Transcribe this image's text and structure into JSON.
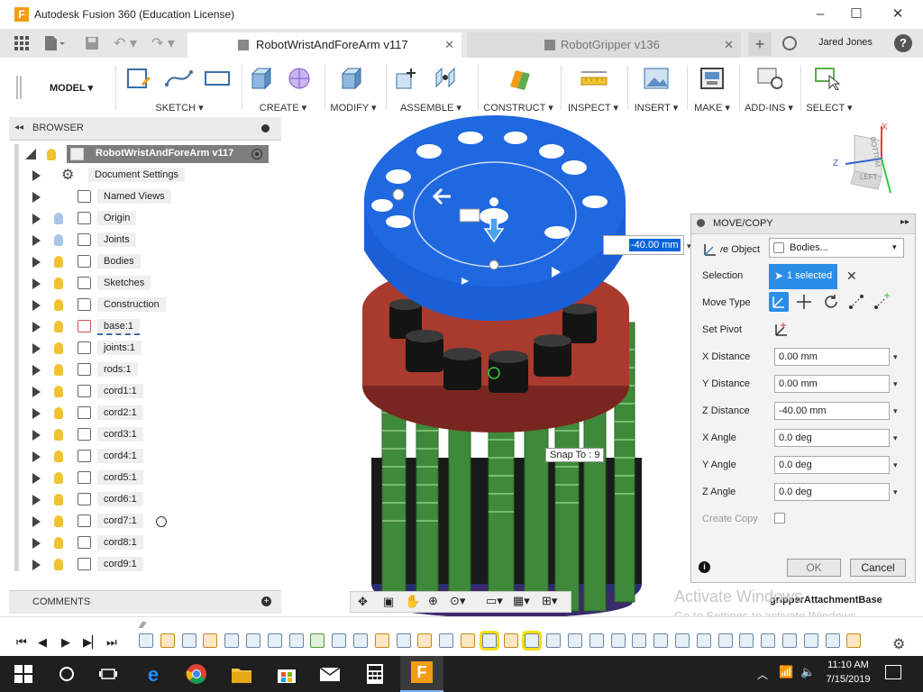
{
  "window": {
    "title": "Autodesk Fusion 360 (Education License)",
    "user": "Jared Jones"
  },
  "tabs": [
    {
      "label": "RobotWristAndForeArm v117"
    },
    {
      "label": "RobotGripper v136"
    }
  ],
  "toolbar": {
    "mode": "MODEL",
    "groups": [
      {
        "label": "SKETCH"
      },
      {
        "label": "CREATE"
      },
      {
        "label": "MODIFY"
      },
      {
        "label": "ASSEMBLE"
      },
      {
        "label": "CONSTRUCT"
      },
      {
        "label": "INSPECT"
      },
      {
        "label": "INSERT"
      },
      {
        "label": "MAKE"
      },
      {
        "label": "ADD-INS"
      },
      {
        "label": "SELECT"
      }
    ]
  },
  "browser": {
    "title": "BROWSER",
    "root": "RobotWristAndForeArm v117",
    "items": [
      {
        "label": "Document Settings"
      },
      {
        "label": "Named Views"
      },
      {
        "label": "Origin"
      },
      {
        "label": "Joints"
      },
      {
        "label": "Bodies"
      },
      {
        "label": "Sketches"
      },
      {
        "label": "Construction"
      },
      {
        "label": "base:1"
      },
      {
        "label": "joints:1"
      },
      {
        "label": "rods:1"
      },
      {
        "label": "cord1:1"
      },
      {
        "label": "cord2:1"
      },
      {
        "label": "cord3:1"
      },
      {
        "label": "cord4:1"
      },
      {
        "label": "cord5:1"
      },
      {
        "label": "cord6:1"
      },
      {
        "label": "cord7:1"
      },
      {
        "label": "cord8:1"
      },
      {
        "label": "cord9:1"
      }
    ],
    "comments_label": "COMMENTS"
  },
  "viewport": {
    "inline_value": "-40.00 mm",
    "snap_tooltip": "Snap To : 9",
    "body_label": "gripperAttachmentBase",
    "watermark_line1": "Activate Windows",
    "watermark_line2": "Go to Settings to activate Windows.",
    "viewcube_labels": [
      "BOTTOM",
      "LEFT"
    ],
    "axes": [
      "X",
      "Z"
    ]
  },
  "dialog": {
    "title": "MOVE/COPY",
    "move_object_label": "Move Object",
    "move_object_value": "Bodies...",
    "selection_label": "Selection",
    "selection_value": "1 selected",
    "move_type_label": "Move Type",
    "set_pivot_label": "Set Pivot",
    "x_distance_label": "X Distance",
    "x_distance": "0.00 mm",
    "y_distance_label": "Y Distance",
    "y_distance": "0.00 mm",
    "z_distance_label": "Z Distance",
    "z_distance": "-40.00 mm",
    "x_angle_label": "X Angle",
    "x_angle": "0.0 deg",
    "y_angle_label": "Y Angle",
    "y_angle": "0.0 deg",
    "z_angle_label": "Z Angle",
    "z_angle": "0.0 deg",
    "create_copy_label": "Create Copy",
    "ok_label": "OK",
    "cancel_label": "Cancel"
  },
  "taskbar": {
    "time": "11:10 AM",
    "date": "7/15/2019"
  },
  "colors": {
    "accent_blue": "#1a5fd6",
    "selection_blue": "#2a8de6",
    "disk_red": "#a83a2e",
    "rod_green": "#3f8a3a",
    "bulb_yellow": "#f1c232"
  }
}
